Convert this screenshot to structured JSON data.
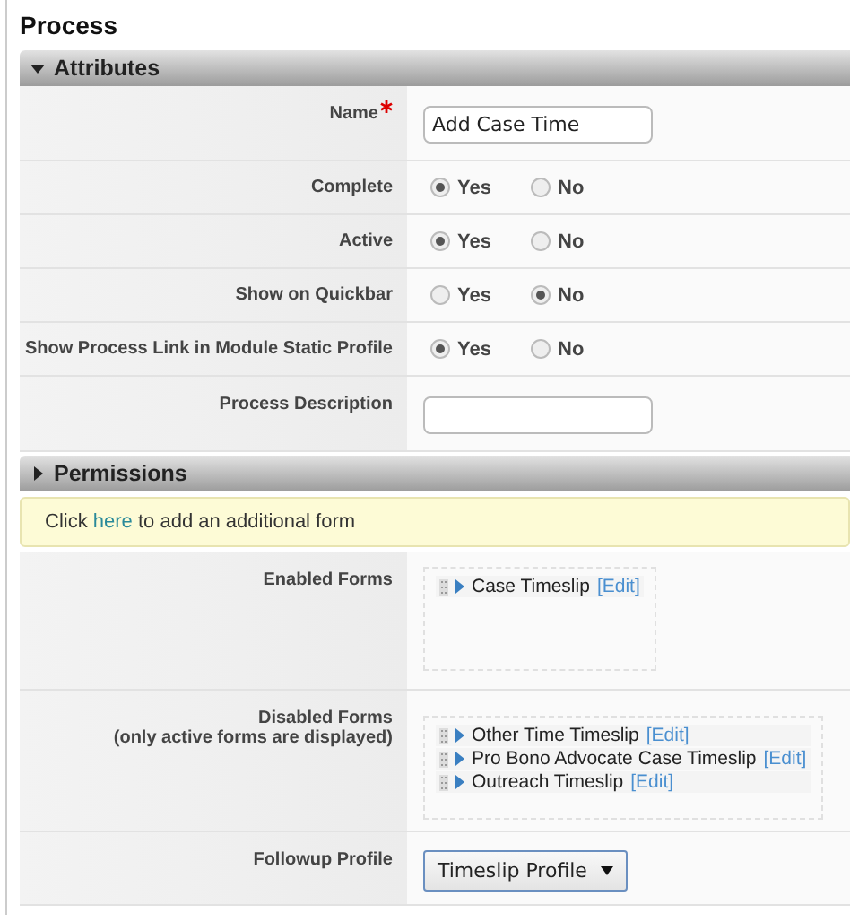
{
  "title": "Process",
  "sections": [
    {
      "heading": "Attributes",
      "expanded": true,
      "rows": [
        {
          "kind": "text",
          "label": "Name",
          "required": true,
          "value": "Add Case Time"
        },
        {
          "kind": "radio",
          "label": "Complete",
          "options": [
            {
              "label": "Yes",
              "selected": true
            },
            {
              "label": "No",
              "selected": false
            }
          ]
        },
        {
          "kind": "radio",
          "label": "Active",
          "options": [
            {
              "label": "Yes",
              "selected": true
            },
            {
              "label": "No",
              "selected": false
            }
          ]
        },
        {
          "kind": "radio",
          "label": "Show on Quickbar",
          "options": [
            {
              "label": "Yes",
              "selected": false
            },
            {
              "label": "No",
              "selected": true
            }
          ]
        },
        {
          "kind": "radio",
          "label": "Show Process Link in Module Static Profile",
          "options": [
            {
              "label": "Yes",
              "selected": true
            },
            {
              "label": "No",
              "selected": false
            }
          ]
        },
        {
          "kind": "text",
          "label": "Process Description",
          "required": false,
          "value": ""
        }
      ]
    },
    {
      "heading": "Permissions",
      "expanded": false,
      "notice": {
        "before": "Click",
        "link": "here",
        "after": "to add an additional form"
      },
      "rows": [
        {
          "kind": "list",
          "label": "Enabled Forms",
          "items": [
            {
              "name": "Case Timeslip",
              "edit": "[Edit]"
            }
          ]
        },
        {
          "kind": "list",
          "label": "Disabled Forms",
          "note": "(only active forms are displayed)",
          "items": [
            {
              "name": "Other Time Timeslip",
              "edit": "[Edit]"
            },
            {
              "name": "Pro Bono Advocate Case Timeslip",
              "edit": "[Edit]"
            },
            {
              "name": "Outreach Timeslip",
              "edit": "[Edit]"
            }
          ]
        },
        {
          "kind": "select",
          "label": "Followup Profile",
          "value": "Timeslip Profile"
        }
      ]
    }
  ]
}
